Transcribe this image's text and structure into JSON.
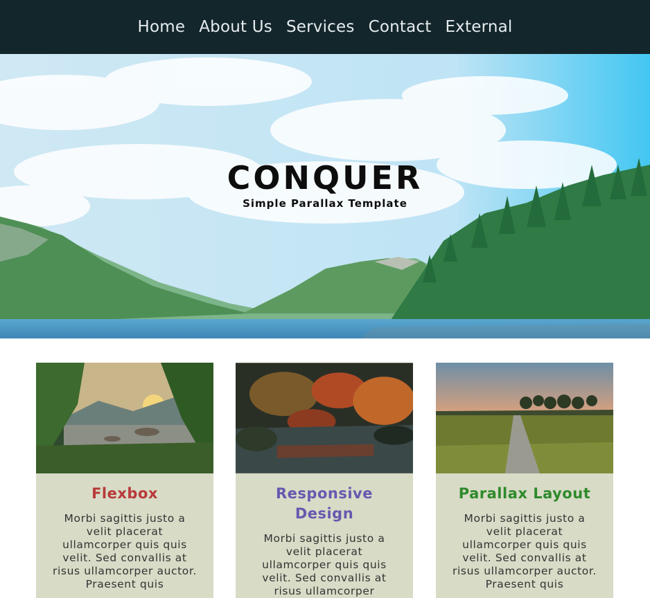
{
  "nav": {
    "items": [
      {
        "label": "Home"
      },
      {
        "label": "About Us"
      },
      {
        "label": "Services"
      },
      {
        "label": "Contact"
      },
      {
        "label": "External"
      }
    ]
  },
  "hero": {
    "title": "CONQUER",
    "subtitle": "Simple Parallax Template"
  },
  "cards": [
    {
      "title": "Flexbox",
      "title_color": "#b83a3a",
      "text": "Morbi sagittis justo a velit placerat ullamcorper quis quis velit. Sed convallis at risus ullamcorper auctor. Praesent quis"
    },
    {
      "title": "Responsive Design",
      "title_color": "#6659b0",
      "text": "Morbi sagittis justo a velit placerat ullamcorper quis quis velit. Sed convallis at risus ullamcorper"
    },
    {
      "title": "Parallax Layout",
      "title_color": "#2f8a2c",
      "text": "Morbi sagittis justo a velit placerat ullamcorper quis quis velit. Sed convallis at risus ullamcorper auctor. Praesent quis"
    }
  ],
  "colors": {
    "navbar_bg": "#13262b",
    "card_bg": "#d8dbc6"
  }
}
